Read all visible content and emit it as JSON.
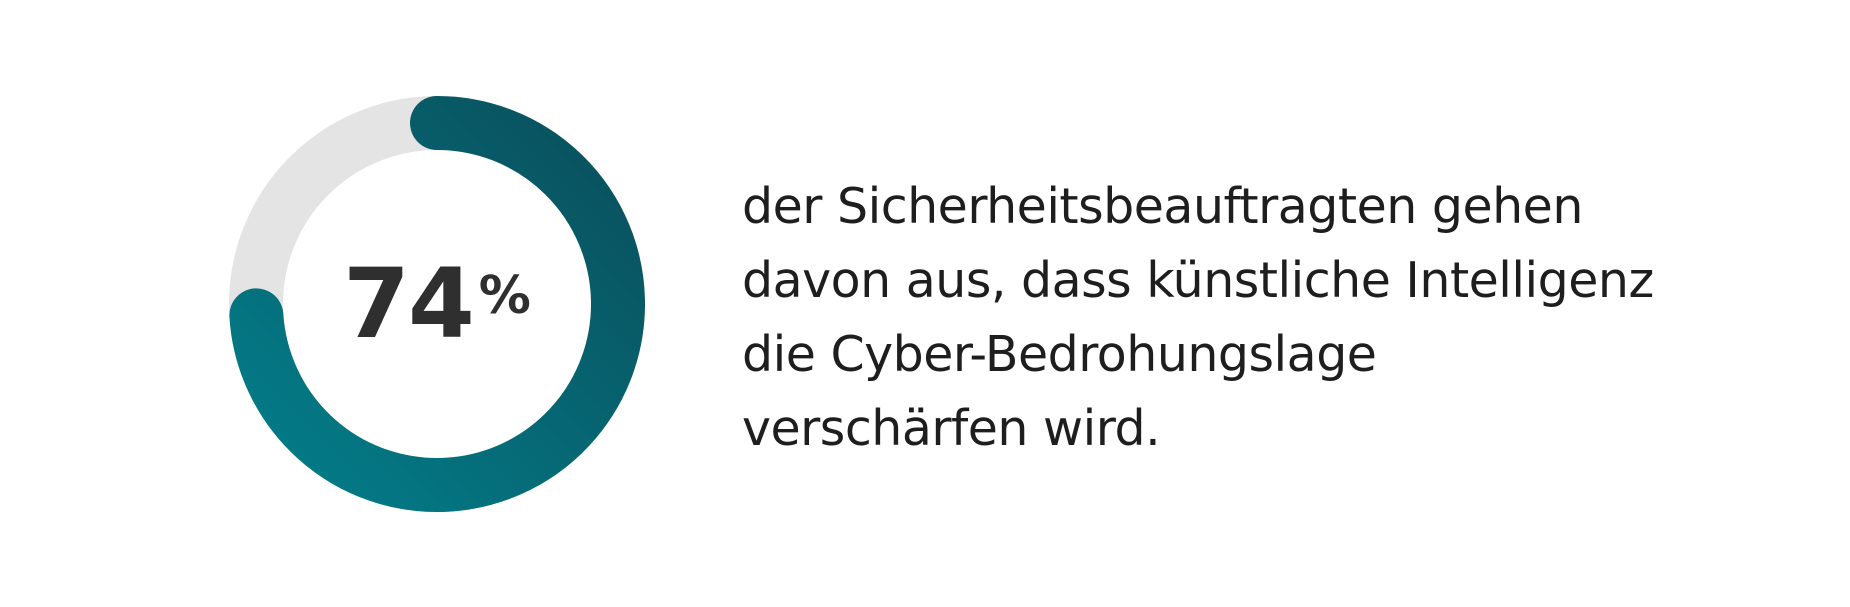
{
  "chart_data": {
    "type": "pie",
    "categories": [
      "74%"
    ],
    "values": [
      74
    ],
    "value_label": "74",
    "unit": "%",
    "total": 100,
    "colors": {
      "progress_start": "#0a4f5c",
      "progress_end": "#027e8a",
      "track": "#e4e4e4",
      "text": "#2f2f2f"
    }
  },
  "statement": {
    "lines": [
      "der Sicherheitsbeauftragten gehen",
      "davon aus, dass künstliche Intelligenz",
      "die Cyber-Bedrohungslage",
      "verschärfen wird."
    ]
  }
}
